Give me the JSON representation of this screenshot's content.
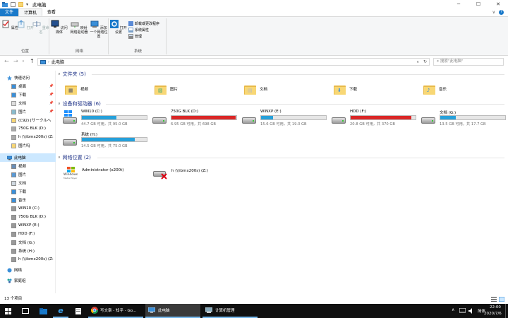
{
  "window": {
    "title": "此电脑",
    "minimize": "─",
    "maximize": "☐",
    "close": "✕"
  },
  "ribbon_tabs": {
    "file": "文件",
    "computer": "计算机",
    "view": "查看",
    "help": "?"
  },
  "ribbon": {
    "location_group": "位置",
    "properties": "属性",
    "open": "打开",
    "rename": "重命名",
    "network_group": "网络",
    "access_media": "访问媒体",
    "map_drive": "映射网络驱动器",
    "add_location": "添加一个网络位置",
    "system_group": "系统",
    "open_settings": "打开设置",
    "uninstall": "卸载或更改程序",
    "system_properties": "系统属性",
    "manage": "管理"
  },
  "address": {
    "back": "←",
    "forward": "→",
    "recent": "∨",
    "up": "↑",
    "path": "此电脑",
    "dropdown": "∨",
    "refresh": "↻",
    "search_placeholder": "搜索\"此电脑\""
  },
  "nav": {
    "quick_access": "快速访问",
    "quick_items": [
      {
        "label": "桌面",
        "pinned": true
      },
      {
        "label": "下载",
        "pinned": true
      },
      {
        "label": "文档",
        "pinned": true
      },
      {
        "label": "图片",
        "pinned": true
      },
      {
        "label": "(C92) [サークルヘ",
        "pinned": false
      },
      {
        "label": "750G BLK (D:)",
        "pinned": false
      },
      {
        "label": "h (\\\\ibmx200s) (Z:",
        "pinned": false
      },
      {
        "label": "图片吗",
        "pinned": false
      }
    ],
    "this_pc": "此电脑",
    "pc_items": [
      "视频",
      "图片",
      "文档",
      "下载",
      "音乐",
      "WIN10 (C:)",
      "750G BLK (D:)",
      "WINXP (E:)",
      "HDD (F:)",
      "文档 (G:)",
      "系统 (H:)",
      "h (\\\\ibmx200s) (Z:"
    ],
    "network": "网络",
    "homegroup": "家庭组"
  },
  "sections": {
    "folders": "文件夹 (5)",
    "devices": "设备和驱动器 (6)",
    "network": "网络位置 (2)"
  },
  "folders": [
    "视频",
    "图片",
    "文档",
    "下载",
    "音乐"
  ],
  "drives": [
    {
      "name": "WIN10 (C:)",
      "free": "44.7 GB 可用，共 95.0 GB",
      "used_fraction": 0.53,
      "color": "#26a0da",
      "system": true
    },
    {
      "name": "750G BLK (D:)",
      "free": "6.95 GB 可用，共 698 GB",
      "used_fraction": 0.99,
      "color": "#da2626",
      "system": false
    },
    {
      "name": "WINXP (E:)",
      "free": "15.6 GB 可用，共 19.0 GB",
      "used_fraction": 0.18,
      "color": "#26a0da",
      "system": false
    },
    {
      "name": "HDD (F:)",
      "free": "20.8 GB 可用，共 370 GB",
      "used_fraction": 0.94,
      "color": "#da2626",
      "system": false
    },
    {
      "name": "文档 (G:)",
      "free": "13.5 GB 可用，共 17.7 GB",
      "used_fraction": 0.24,
      "color": "#26a0da",
      "system": false
    },
    {
      "name": "系统 (H:)",
      "free": "14.5 GB 可用，共 75.0 GB",
      "used_fraction": 0.81,
      "color": "#26a0da",
      "system": false
    }
  ],
  "network_locations": [
    {
      "name": "Administrator (x200t)",
      "logo_text": "Windows",
      "logo_sub": "Media Player"
    },
    {
      "name": "h (\\\\ibmx200s) (Z:)"
    }
  ],
  "status": {
    "item_count": "13 个项目"
  },
  "taskbar": {
    "chrome_title": "写文章 - 知乎 - Go...",
    "explorer_title": "此电脑",
    "manager_title": "计算机管理",
    "ime": "简体",
    "time": "22:00",
    "date": "2020/7/6"
  }
}
